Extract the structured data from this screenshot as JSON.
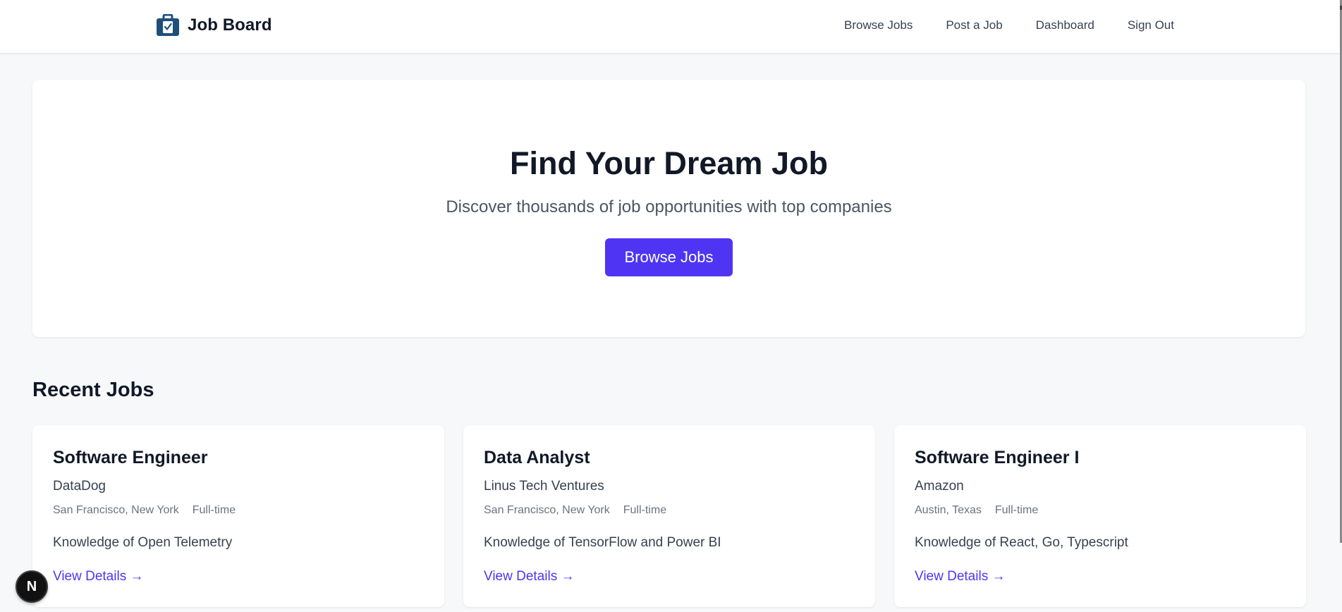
{
  "header": {
    "brand": "Job Board",
    "logo_icon": "briefcase-check-icon",
    "nav": [
      {
        "label": "Browse Jobs"
      },
      {
        "label": "Post a Job"
      },
      {
        "label": "Dashboard"
      },
      {
        "label": "Sign Out"
      }
    ]
  },
  "hero": {
    "title": "Find Your Dream Job",
    "subtitle": "Discover thousands of job opportunities with top companies",
    "button_label": "Browse Jobs"
  },
  "recent": {
    "title": "Recent Jobs",
    "jobs": [
      {
        "title": "Software Engineer",
        "company": "DataDog",
        "location": "San Francisco, New York",
        "type": "Full-time",
        "description": "Knowledge of Open Telemetry",
        "link": "View Details →"
      },
      {
        "title": "Data Analyst",
        "company": "Linus Tech Ventures",
        "location": "San Francisco, New York",
        "type": "Full-time",
        "description": "Knowledge of TensorFlow and Power BI",
        "link": "View Details →"
      },
      {
        "title": "Software Engineer I",
        "company": "Amazon",
        "location": "Austin, Texas",
        "type": "Full-time",
        "description": "Knowledge of React, Go, Typescript",
        "link": "View Details →"
      }
    ]
  },
  "dev_badge": {
    "label": "N"
  },
  "colors": {
    "accent": "#4f35f3",
    "logo": "#1e4f7a",
    "page_background": "#f7f8fa"
  }
}
